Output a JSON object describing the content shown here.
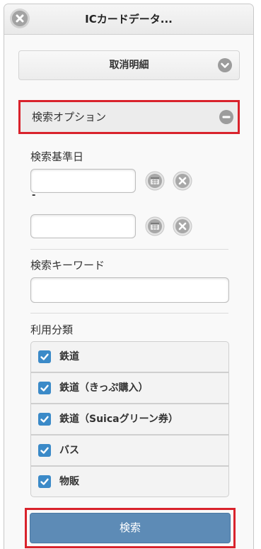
{
  "dialog": {
    "title": "ICカードデータ...",
    "close_icon": "close-icon"
  },
  "cancel_details": {
    "label": "取消明細",
    "icon": "chevron-down-icon"
  },
  "search_options": {
    "label": "検索オプション",
    "icon": "minus-icon"
  },
  "date_filter": {
    "label": "検索基準日",
    "separator": "-",
    "start_value": "",
    "end_value": "",
    "calendar_icon": "calendar-icon",
    "clear_icon": "clear-icon"
  },
  "keyword_filter": {
    "label": "検索キーワード",
    "value": ""
  },
  "category_filter": {
    "label": "利用分類",
    "items": [
      {
        "label": "鉄道",
        "checked": true
      },
      {
        "label": "鉄道（きっぷ購入）",
        "checked": true
      },
      {
        "label": "鉄道（Suicaグリーン券）",
        "checked": true
      },
      {
        "label": "バス",
        "checked": true
      },
      {
        "label": "物販",
        "checked": true
      }
    ]
  },
  "search_button": {
    "label": "検索"
  },
  "colors": {
    "accent_blue": "#5d8bb6",
    "checkbox_blue": "#3b8ac8",
    "highlight_red": "#d9232c"
  }
}
